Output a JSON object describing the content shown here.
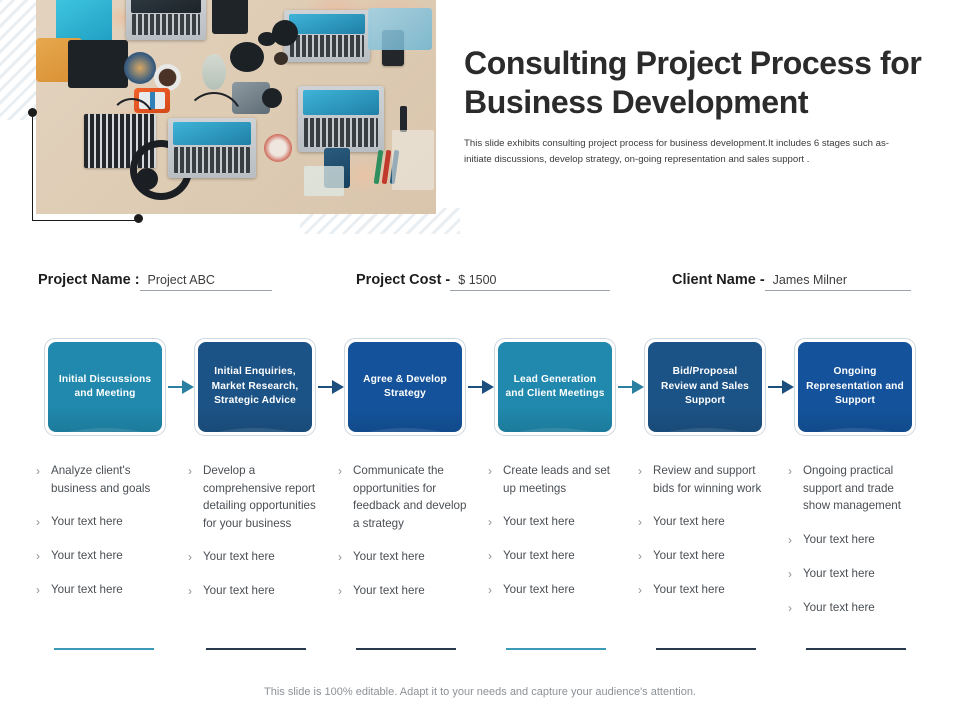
{
  "header": {
    "title": "Consulting Project Process for Business Development",
    "subtitle": "This slide exhibits consulting project process for business development.It includes 6 stages such as- initiate discussions, develop strategy, on-going representation and sales support ."
  },
  "meta": {
    "project_name": {
      "label": "Project Name :",
      "value": "Project ABC",
      "placeholder": "Project ABC"
    },
    "project_cost": {
      "label": "Project Cost -",
      "value": "$ 1500",
      "placeholder": "$ 1500"
    },
    "client_name": {
      "label": "Client Name -",
      "value": "James Milner",
      "placeholder": "James Milner"
    }
  },
  "colors": {
    "teal": "#2089ad",
    "navy": "#1c5386",
    "royal": "#14539b",
    "arrow_teal": "#2b7fa0",
    "arrow_navy": "#1c4f7e",
    "underline_teal": "#3b9ab5",
    "underline_navy": "#27394a",
    "title": "#2b2b2b",
    "body_text": "#4a4f54",
    "footer": "#8d9297"
  },
  "stages": [
    {
      "label": "Initial Discussions and Meeting",
      "color": "#2089ad"
    },
    {
      "label": "Initial Enquiries, Market Research, Strategic Advice",
      "color": "#1c5386"
    },
    {
      "label": "Agree & Develop Strategy",
      "color": "#14539b"
    },
    {
      "label": "Lead Generation and Client Meetings",
      "color": "#2089ad"
    },
    {
      "label": "Bid/Proposal Review and Sales Support",
      "color": "#1c5386"
    },
    {
      "label": "Ongoing Representation and Support",
      "color": "#14539b"
    }
  ],
  "arrows": [
    {
      "color": "#2b7fa0"
    },
    {
      "color": "#1c4f7e"
    },
    {
      "color": "#1c4f7e"
    },
    {
      "color": "#2b7fa0"
    },
    {
      "color": "#1c4f7e"
    }
  ],
  "bullet_marker": "›",
  "columns": [
    {
      "underline_color": "#3b9ab5",
      "bullets": [
        "Analyze client's business and goals",
        "Your text here",
        "Your text here",
        "Your text here"
      ]
    },
    {
      "underline_color": "#27394a",
      "bullets": [
        "Develop a comprehensive report detailing opportunities for your business",
        "Your text here",
        "Your text here"
      ]
    },
    {
      "underline_color": "#27394a",
      "bullets": [
        "Communicate the opportunities for feedback and develop a strategy",
        "Your text here",
        "Your text here"
      ]
    },
    {
      "underline_color": "#3b9ab5",
      "bullets": [
        "Create leads and set up meetings",
        "Your text here",
        "Your text here",
        "Your text here"
      ]
    },
    {
      "underline_color": "#27394a",
      "bullets": [
        "Review and support bids for winning work",
        "Your text here",
        "Your text here",
        "Your text here"
      ]
    },
    {
      "underline_color": "#27394a",
      "bullets": [
        "Ongoing practical support and trade show management",
        "Your text here",
        "Your text here",
        "Your text here"
      ]
    }
  ],
  "footer": {
    "note": "This slide is 100% editable. Adapt it to your needs and capture your audience's attention."
  },
  "image": {
    "alt": "team-desk-photo"
  }
}
